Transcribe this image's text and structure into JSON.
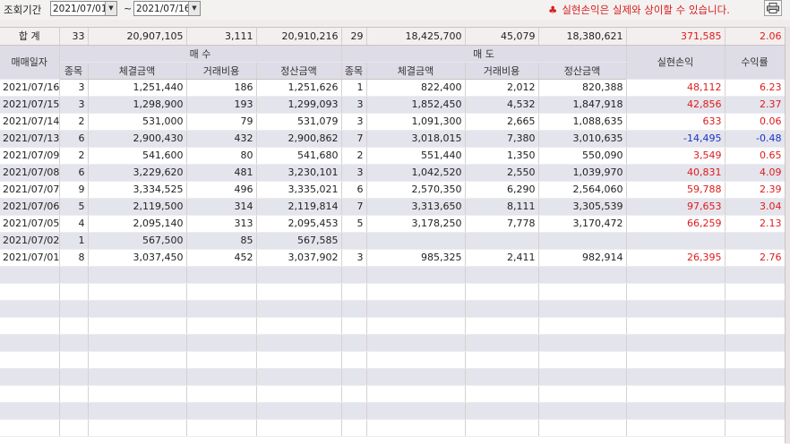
{
  "toolbar": {
    "period_label": "조회기간",
    "start_date": "2021/07/01",
    "end_date": "2021/07/16",
    "tilde": "~",
    "notice_icon": "♣",
    "notice": "실현손익은 실제와 상이할 수 있습니다.",
    "print_icon": "print-icon"
  },
  "total": {
    "label": "합 계",
    "buy_count": "33",
    "buy_amount": "20,907,105",
    "buy_fee": "3,111",
    "buy_settle": "20,910,216",
    "sell_count": "29",
    "sell_amount": "18,425,700",
    "sell_fee": "45,079",
    "sell_settle": "18,380,621",
    "profit": "371,585",
    "rate": "2.06"
  },
  "header": {
    "date": "매매일자",
    "buy_group": "매  수",
    "sell_group": "매  도",
    "profit": "실현손익",
    "rate": "수익률",
    "count": "종목",
    "amount": "체결금액",
    "fee": "거래비용",
    "settle": "정산금액"
  },
  "rows": [
    {
      "date": "2021/07/16",
      "bc": "3",
      "ba": "1,251,440",
      "bf": "186",
      "bs": "1,251,626",
      "sc": "1",
      "sa": "822,400",
      "sf": "2,012",
      "ss": "820,388",
      "p": "48,112",
      "r": "6.23",
      "neg": false
    },
    {
      "date": "2021/07/15",
      "bc": "3",
      "ba": "1,298,900",
      "bf": "193",
      "bs": "1,299,093",
      "sc": "3",
      "sa": "1,852,450",
      "sf": "4,532",
      "ss": "1,847,918",
      "p": "42,856",
      "r": "2.37",
      "neg": false
    },
    {
      "date": "2021/07/14",
      "bc": "2",
      "ba": "531,000",
      "bf": "79",
      "bs": "531,079",
      "sc": "3",
      "sa": "1,091,300",
      "sf": "2,665",
      "ss": "1,088,635",
      "p": "633",
      "r": "0.06",
      "neg": false
    },
    {
      "date": "2021/07/13",
      "bc": "6",
      "ba": "2,900,430",
      "bf": "432",
      "bs": "2,900,862",
      "sc": "7",
      "sa": "3,018,015",
      "sf": "7,380",
      "ss": "3,010,635",
      "p": "-14,495",
      "r": "-0.48",
      "neg": true
    },
    {
      "date": "2021/07/09",
      "bc": "2",
      "ba": "541,600",
      "bf": "80",
      "bs": "541,680",
      "sc": "2",
      "sa": "551,440",
      "sf": "1,350",
      "ss": "550,090",
      "p": "3,549",
      "r": "0.65",
      "neg": false
    },
    {
      "date": "2021/07/08",
      "bc": "6",
      "ba": "3,229,620",
      "bf": "481",
      "bs": "3,230,101",
      "sc": "3",
      "sa": "1,042,520",
      "sf": "2,550",
      "ss": "1,039,970",
      "p": "40,831",
      "r": "4.09",
      "neg": false
    },
    {
      "date": "2021/07/07",
      "bc": "9",
      "ba": "3,334,525",
      "bf": "496",
      "bs": "3,335,021",
      "sc": "6",
      "sa": "2,570,350",
      "sf": "6,290",
      "ss": "2,564,060",
      "p": "59,788",
      "r": "2.39",
      "neg": false
    },
    {
      "date": "2021/07/06",
      "bc": "5",
      "ba": "2,119,500",
      "bf": "314",
      "bs": "2,119,814",
      "sc": "7",
      "sa": "3,313,650",
      "sf": "8,111",
      "ss": "3,305,539",
      "p": "97,653",
      "r": "3.04",
      "neg": false
    },
    {
      "date": "2021/07/05",
      "bc": "4",
      "ba": "2,095,140",
      "bf": "313",
      "bs": "2,095,453",
      "sc": "5",
      "sa": "3,178,250",
      "sf": "7,778",
      "ss": "3,170,472",
      "p": "66,259",
      "r": "2.13",
      "neg": false
    },
    {
      "date": "2021/07/02",
      "bc": "1",
      "ba": "567,500",
      "bf": "85",
      "bs": "567,585",
      "sc": "",
      "sa": "",
      "sf": "",
      "ss": "",
      "p": "",
      "r": "",
      "neg": false
    },
    {
      "date": "2021/07/01",
      "bc": "8",
      "ba": "3,037,450",
      "bf": "452",
      "bs": "3,037,902",
      "sc": "3",
      "sa": "985,325",
      "sf": "2,411",
      "ss": "982,914",
      "p": "26,395",
      "r": "2.76",
      "neg": false
    }
  ],
  "colors": {
    "positive": "#e01a1a",
    "negative": "#1a32c8",
    "header_bg": "#dedce6",
    "alt_row_bg": "#e4e4ec"
  }
}
